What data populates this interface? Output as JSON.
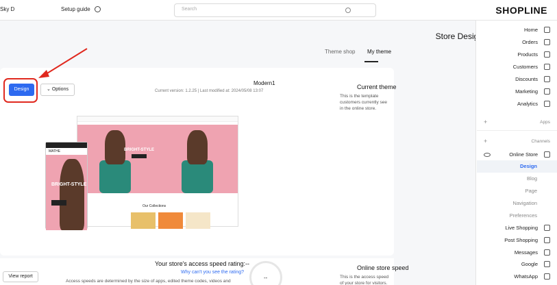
{
  "header": {
    "brand": "SHOPLINE",
    "search_placeholder": "Search",
    "setup_guide": "Setup guide",
    "user": "Sky D"
  },
  "page": {
    "title": "Store Design",
    "tabs": [
      {
        "label": "My theme",
        "active": true
      },
      {
        "label": "Theme shop",
        "active": false
      }
    ]
  },
  "current_theme": {
    "heading": "Current theme",
    "description": "This is the template customers currently see in the online store.",
    "name": "Modern1",
    "meta": "Current version: 1.2.25  |  Last modified at: 2024/05/08 13:07",
    "options_label": "Options",
    "design_label": "Design"
  },
  "preview": {
    "desktop_hero_text": "BRIGHT-STYLE",
    "mobile_hero_text": "BRIGHT-STYLE",
    "collections_label": "Our Collections",
    "brand_mark": "MATHE"
  },
  "speed": {
    "heading": "Online store speed",
    "description": "This is the access speed of your store for visitors.",
    "rating_title": "Your store's access speed rating:--",
    "rating_link": "Why can't you see the rating?",
    "rating_desc": "Access speeds are determined by the size of apps, edited theme codes, videos and",
    "gauge_value": "--",
    "view_report_label": "View report"
  },
  "sidebar": {
    "items": [
      {
        "label": "Home",
        "icon": "home-icon"
      },
      {
        "label": "Orders",
        "icon": "orders-icon"
      },
      {
        "label": "Products",
        "icon": "products-icon"
      },
      {
        "label": "Customers",
        "icon": "customers-icon"
      },
      {
        "label": "Discounts",
        "icon": "discounts-icon"
      },
      {
        "label": "Marketing",
        "icon": "marketing-icon"
      },
      {
        "label": "Analytics",
        "icon": "analytics-icon"
      }
    ],
    "apps_label": "Apps",
    "channels_label": "Channels",
    "online_store": "Online Store",
    "online_store_sub": [
      "Design",
      "Blog",
      "Page",
      "Navigation",
      "Preferences"
    ],
    "channel_items": [
      {
        "label": "Live Shopping",
        "icon": "live-icon"
      },
      {
        "label": "Post Shopping",
        "icon": "post-icon"
      },
      {
        "label": "Messages",
        "icon": "messages-icon"
      },
      {
        "label": "Google",
        "icon": "google-icon"
      },
      {
        "label": "WhatsApp",
        "icon": "whatsapp-icon"
      }
    ]
  },
  "colors": {
    "accent": "#2d6af0",
    "highlight": "#e0281e",
    "hero_pink": "#efa3b1"
  }
}
